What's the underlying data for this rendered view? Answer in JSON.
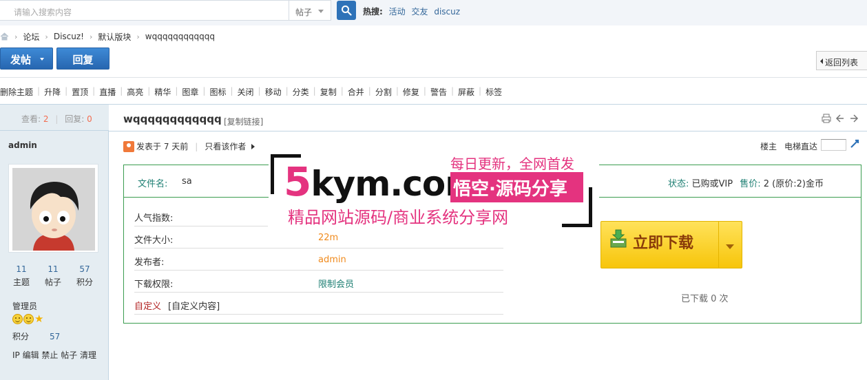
{
  "search": {
    "placeholder": "请输入搜索内容",
    "type": "帖子",
    "hot_label": "热搜:",
    "hot_links": [
      "活动",
      "交友",
      "discuz"
    ]
  },
  "breadcrumb": [
    "论坛",
    "Discuz!",
    "默认版块",
    "wqqqqqqqqqqqq"
  ],
  "toolbar": {
    "post_label": "发帖",
    "reply_label": "回复",
    "back_label": "返回列表"
  },
  "mod_actions": [
    "删除主题",
    "升降",
    "置顶",
    "直播",
    "高亮",
    "精华",
    "图章",
    "图标",
    "关闭",
    "移动",
    "分类",
    "复制",
    "合并",
    "分割",
    "修复",
    "警告",
    "屏蔽",
    "标签"
  ],
  "thread": {
    "views_label": "查看:",
    "views": "2",
    "replies_label": "回复:",
    "replies": "0",
    "title": "wqqqqqqqqqqqq",
    "copy_link": "[复制链接]"
  },
  "author": {
    "name": "admin",
    "stats": [
      {
        "num": "11",
        "label": "主题"
      },
      {
        "num": "11",
        "label": "帖子"
      },
      {
        "num": "57",
        "label": "积分"
      }
    ],
    "group": "管理员",
    "credit_label": "积分",
    "credit_value": "57",
    "mod_links": "IP 编辑 禁止 帖子 清理"
  },
  "post": {
    "posted_at": "发表于 7 天前",
    "only_author": "只看该作者",
    "floor_label": "楼主",
    "jump_label": "电梯直达"
  },
  "attachment": {
    "filename_label": "文件名:",
    "filename": "sa",
    "status_label": "状态:",
    "status_value": "已购或VIP",
    "price_label": "售价:",
    "price_value": "2 (原价:2)金币",
    "rows": [
      {
        "key": "人气指数:",
        "value": ""
      },
      {
        "key": "文件大小:",
        "value": "22m"
      },
      {
        "key": "发布者:",
        "value": "admin"
      },
      {
        "key": "下载权限:",
        "value": "限制会员"
      }
    ],
    "custom_key": "自定义",
    "custom_value": "[自定义内容]",
    "download_label": "立即下载",
    "download_count": "已下载 0 次"
  },
  "watermark": {
    "logo_five": "5",
    "logo_rest": "kym.com",
    "tag1": "每日更新，全网首发",
    "tag2": "悟空·源码分享",
    "tag3": "精品网站源码/商业系统分享网"
  },
  "colors": {
    "primary": "#2e72b8",
    "accent_orange": "#f08a1c",
    "teal": "#1e7f73",
    "border_green": "#3a9c4f",
    "watermark_pink": "#e4337f"
  }
}
